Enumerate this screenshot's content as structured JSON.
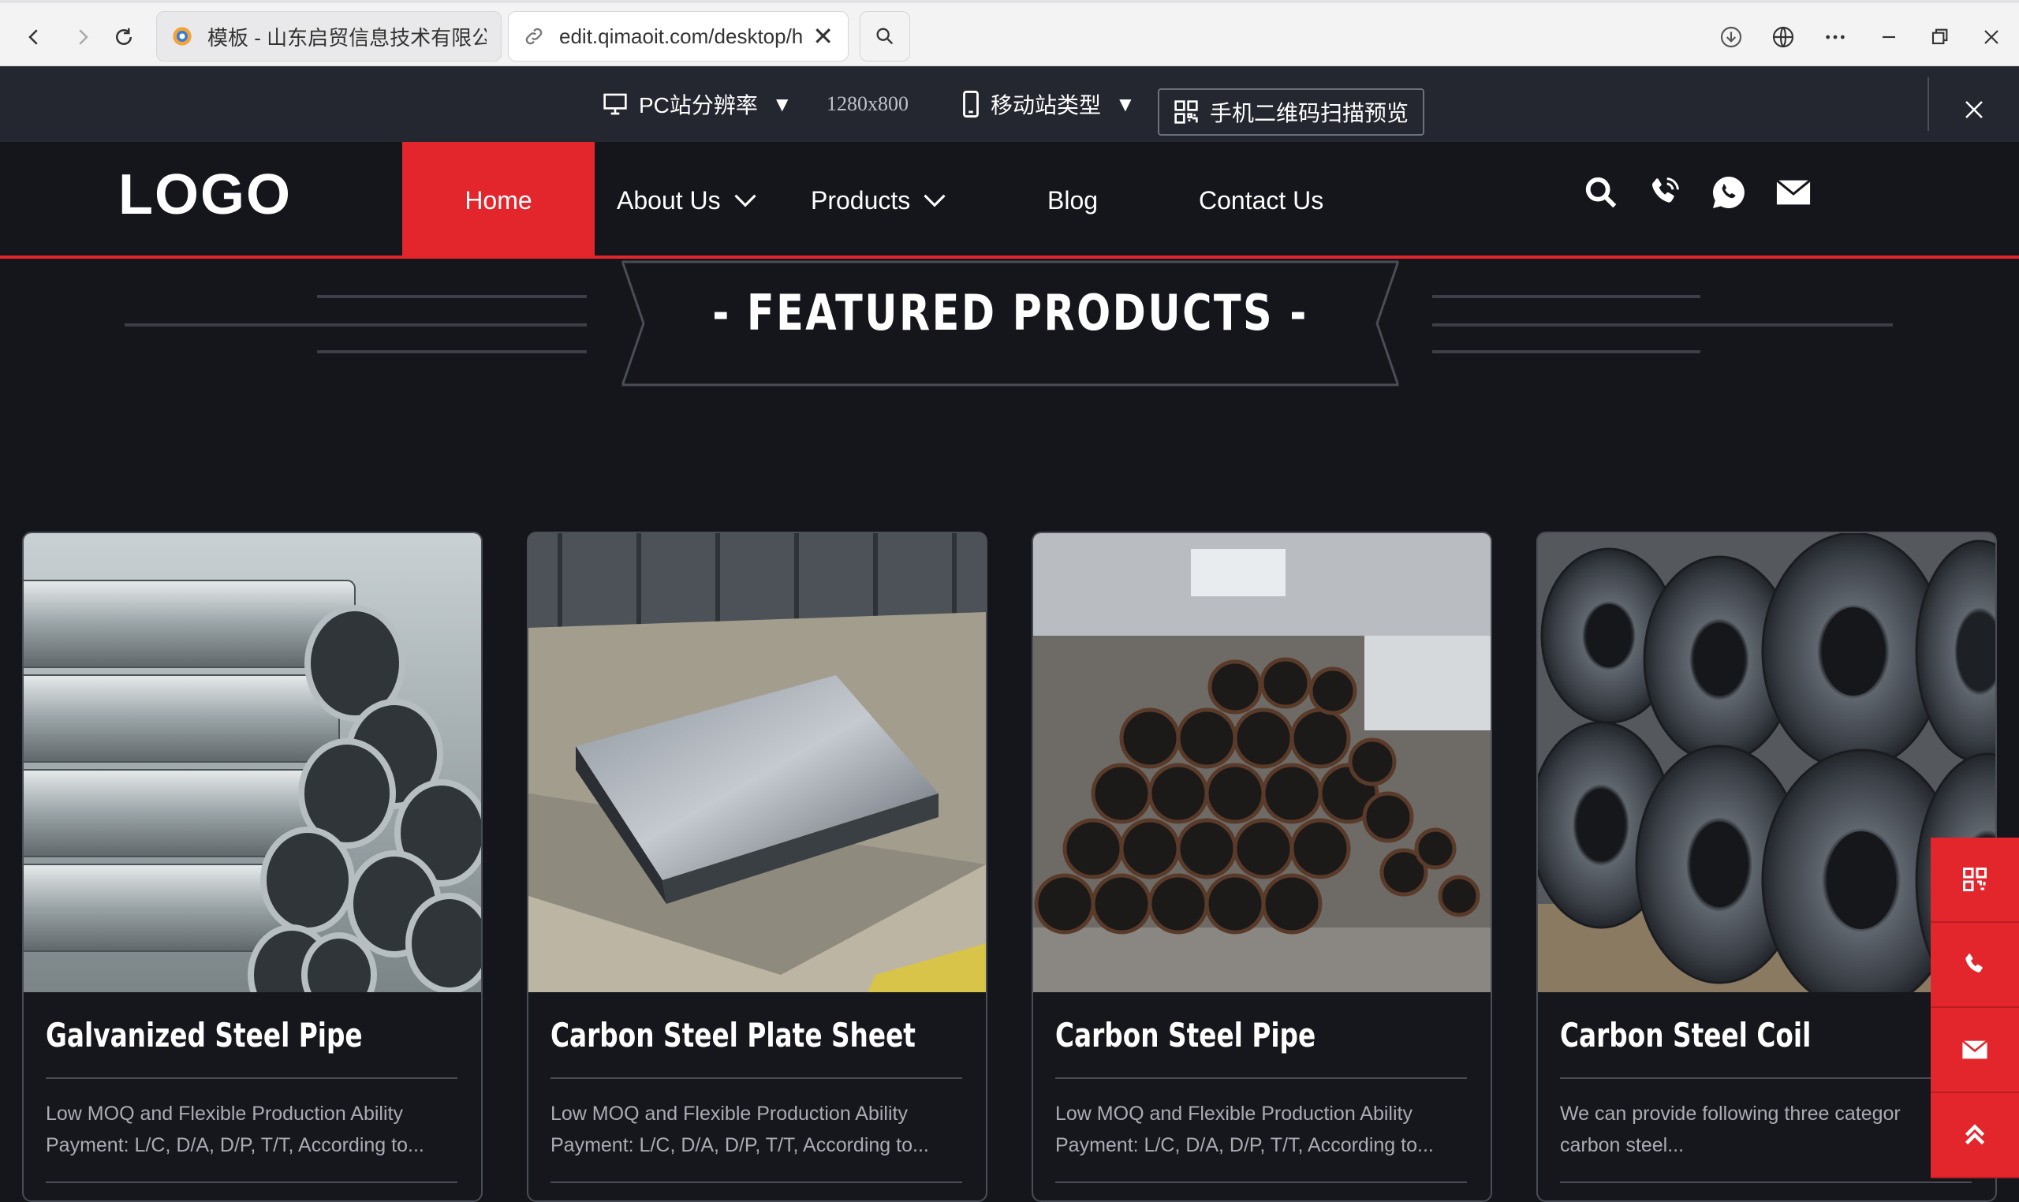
{
  "browser": {
    "tab1_title": "模板 - 山东启贸信息技术有限公司",
    "tab2_url": "edit.qimaoit.com/desktop/h"
  },
  "editor": {
    "resolution_label": "PC站分辨率",
    "resolution_value": "1280x800",
    "mobile_label": "移动站类型",
    "qr_label": "手机二维码扫描预览"
  },
  "site": {
    "logo": "LOGO",
    "menu": {
      "home": "Home",
      "about": "About Us",
      "products": "Products",
      "blog": "Blog",
      "contact": "Contact Us"
    },
    "section_title": "- FEATURED PRODUCTS -",
    "products": [
      {
        "title": "Galvanized Steel Pipe",
        "desc1": "Low MOQ and Flexible Production Ability",
        "desc2": "Payment: L/C, D/A, D/P, T/T, According to..."
      },
      {
        "title": "Carbon Steel Plate Sheet",
        "desc1": "Low MOQ and Flexible Production Ability",
        "desc2": "Payment: L/C, D/A, D/P, T/T, According to..."
      },
      {
        "title": "Carbon Steel Pipe",
        "desc1": "Low MOQ and Flexible Production Ability",
        "desc2": "Payment: L/C, D/A, D/P, T/T, According to..."
      },
      {
        "title": "Carbon Steel Coil",
        "desc1": "We can provide following three categor",
        "desc2": "carbon steel..."
      }
    ]
  },
  "colors": {
    "accent": "#e3262c",
    "background": "#15161c",
    "toolbar": "#24272f"
  },
  "icons": [
    "back-icon",
    "forward-icon",
    "refresh-icon",
    "search-icon",
    "download-icon",
    "globe-icon",
    "more-icon",
    "minimize-icon",
    "restore-icon",
    "close-icon",
    "monitor-icon",
    "phone-device-icon",
    "qr-code-icon",
    "phone-call-icon",
    "whatsapp-icon",
    "mail-icon",
    "chevron-up-icon"
  ]
}
